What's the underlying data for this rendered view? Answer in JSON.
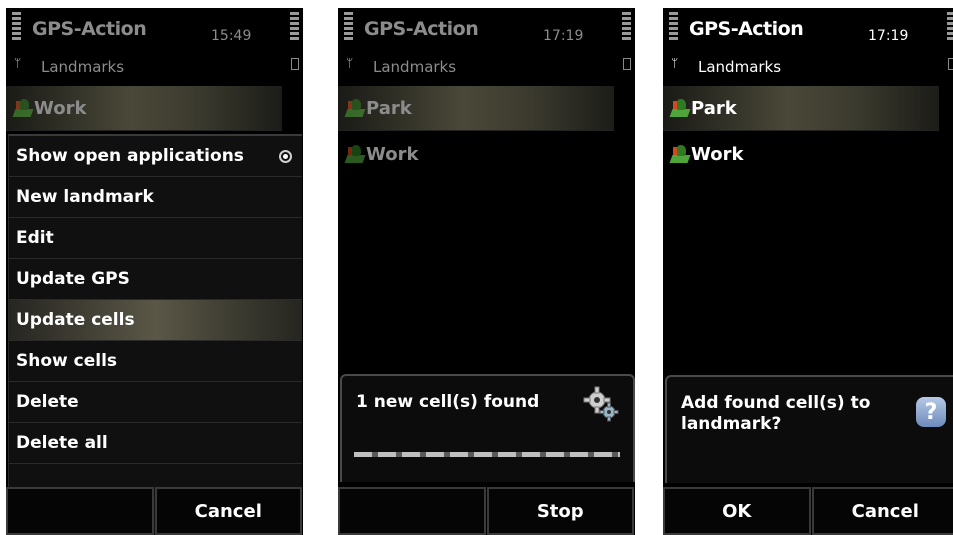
{
  "screens": [
    {
      "app_title": "GPS-Action",
      "clock": "15:49",
      "subtitle": "Landmarks",
      "list": [
        "Work"
      ],
      "menu": {
        "items": [
          "Show open applications",
          "New landmark",
          "Edit",
          "Update GPS",
          "Update cells",
          "Show cells",
          "Delete",
          "Delete all"
        ],
        "selected": "Update cells"
      },
      "softkeys": [
        "",
        "Cancel"
      ]
    },
    {
      "app_title": "GPS-Action",
      "clock": "17:19",
      "subtitle": "Landmarks",
      "list": [
        "Park",
        "Work"
      ],
      "dialog": {
        "text": "1 new cell(s) found",
        "icon": "gear-icon"
      },
      "softkeys": [
        "",
        "Stop"
      ]
    },
    {
      "app_title": "GPS-Action",
      "clock": "17:19",
      "subtitle": "Landmarks",
      "list": [
        "Park",
        "Work"
      ],
      "dialog": {
        "text": "Add found cell(s) to landmark?",
        "icon": "help-icon",
        "icon_glyph": "?"
      },
      "softkeys": [
        "OK",
        "Cancel"
      ]
    }
  ],
  "colors": {
    "background": "#000000",
    "highlight": "#4a4838",
    "help_icon": "#7f9ccb"
  }
}
